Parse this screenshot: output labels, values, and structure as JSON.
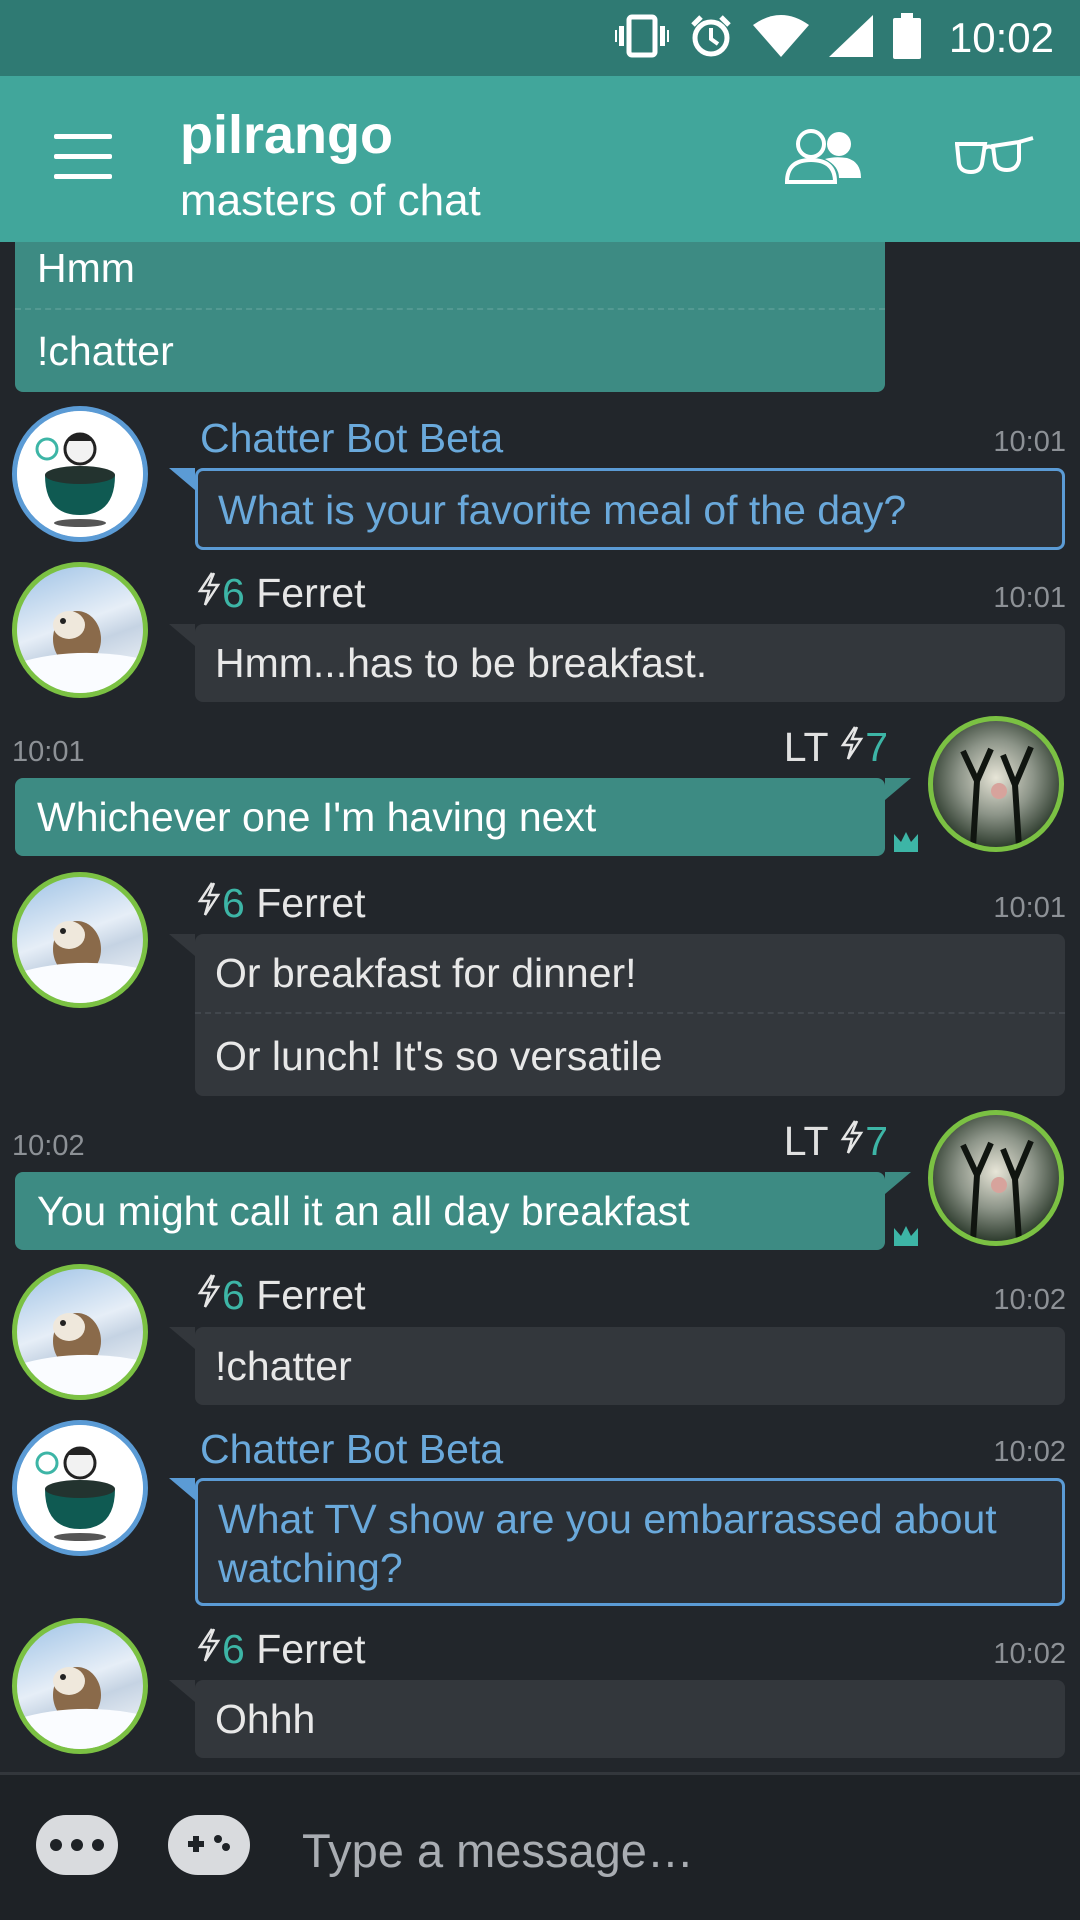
{
  "status": {
    "time": "10:02"
  },
  "header": {
    "title": "pilrango",
    "subtitle": "masters of chat"
  },
  "messages": [
    {
      "lines": [
        "Hmm",
        "!chatter"
      ]
    },
    {
      "author": "Chatter Bot Beta",
      "time": "10:01",
      "text": "What is your favorite meal of the day?"
    },
    {
      "author": "Ferret",
      "level": "6",
      "time": "10:01",
      "text": "Hmm...has to be breakfast."
    },
    {
      "author": "LT",
      "level": "7",
      "time": "10:01",
      "text": "Whichever one I'm having next"
    },
    {
      "author": "Ferret",
      "level": "6",
      "time": "10:01",
      "lines": [
        "Or breakfast for dinner!",
        "Or lunch! It's so versatile"
      ]
    },
    {
      "author": "LT",
      "level": "7",
      "time": "10:02",
      "text": "You might call it an all day breakfast"
    },
    {
      "author": "Ferret",
      "level": "6",
      "time": "10:02",
      "text": "!chatter"
    },
    {
      "author": "Chatter Bot Beta",
      "time": "10:02",
      "text": "What TV show are you embarrassed about watching?"
    },
    {
      "author": "Ferret",
      "level": "6",
      "time": "10:02",
      "text": "Ohhh"
    }
  ],
  "composer": {
    "placeholder": "Type a message…"
  },
  "icons": {
    "status": [
      "vibrate-icon",
      "alarm-icon",
      "wifi-icon",
      "signal-icon",
      "battery-icon"
    ],
    "header": [
      "menu-icon",
      "users-icon",
      "glasses-icon"
    ],
    "messages": [
      "lightning-icon",
      "crown-icon"
    ],
    "composer": [
      "more-icon",
      "gamepad-icon"
    ]
  },
  "colors": {
    "status_bar": "#2f7a73",
    "app_bar": "#41a69b",
    "background": "#22262b",
    "own_bubble": "#3d8b83",
    "other_bubble": "#33373c",
    "bot_accent": "#5b9bd5",
    "user_ring": "#7bc143",
    "level_text": "#3db5a6"
  }
}
